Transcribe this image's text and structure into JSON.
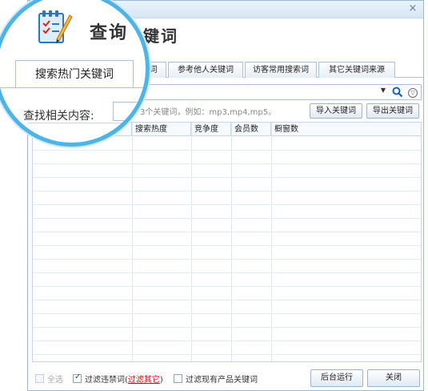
{
  "window": {
    "title": "查询关键词",
    "close_glyph": "×"
  },
  "tabs": [
    {
      "label": "词"
    },
    {
      "label": "参考他人关键词"
    },
    {
      "label": "访客常用搜索词"
    },
    {
      "label": "其它关键词来源"
    }
  ],
  "magnifier": {
    "title": "查询",
    "active_tab": "搜索热门关键词",
    "search_label": "查找相关内容:"
  },
  "search": {
    "hint": "3个关键词，例如：mp3,mp4,mp5。"
  },
  "buttons": {
    "import": "导入关键词",
    "export": "导出关键词",
    "run_background": "后台运行",
    "close": "关闭"
  },
  "grid": {
    "columns": [
      "",
      "搜索热度",
      "竞争度",
      "会员数",
      "橱窗数"
    ]
  },
  "footer": {
    "select_all": "全选",
    "filter_banned_prefix": "过滤违禁词(",
    "filter_other_link": "过滤其它",
    "filter_banned_suffix": ")",
    "filter_existing": "过滤现有产品关键词"
  },
  "icons": [
    "app-logo-icon",
    "close-icon",
    "dropdown-arrow-icon",
    "search-icon",
    "history-icon",
    "notepad-icon"
  ],
  "colors": {
    "accent": "#4fb3e6",
    "border": "#a9c3dc",
    "link": "#d40000"
  }
}
